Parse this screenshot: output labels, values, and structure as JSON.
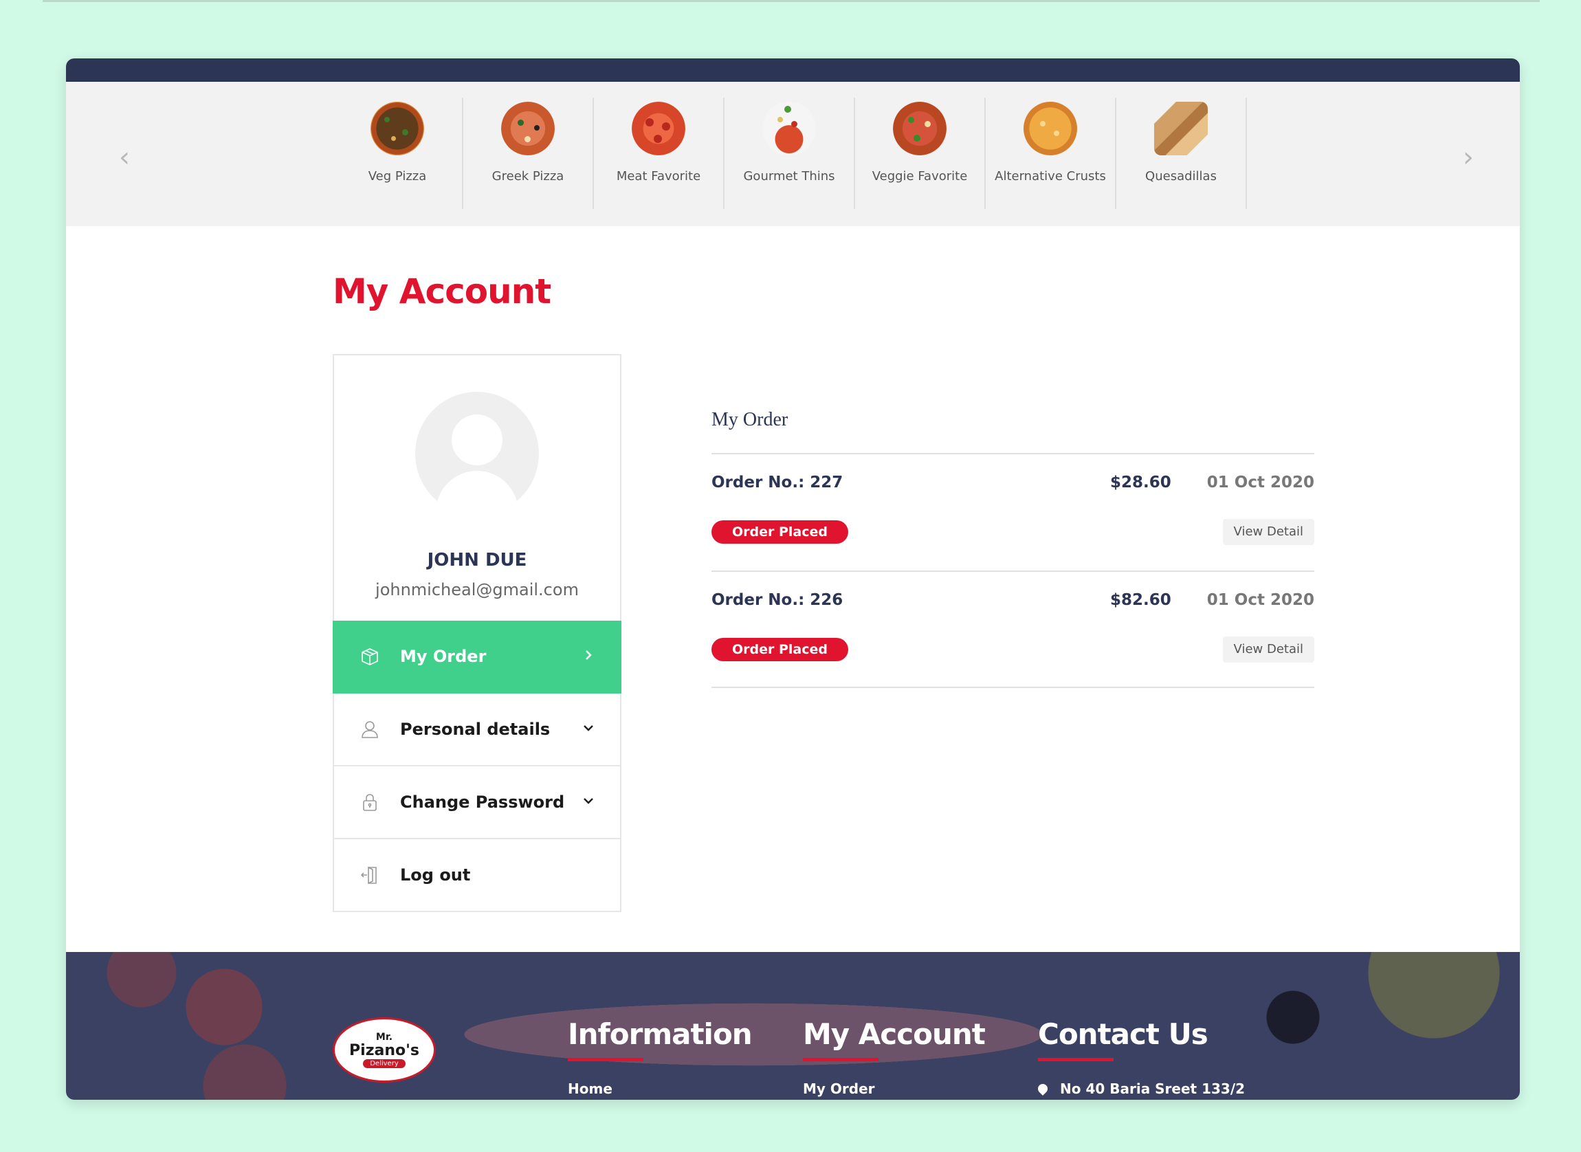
{
  "categories": [
    {
      "label": "Veg Pizza",
      "img": "veg-pizza-image"
    },
    {
      "label": "Greek Pizza",
      "img": "greek-pizza-image"
    },
    {
      "label": "Meat Favorite",
      "img": "meat-favorite-image"
    },
    {
      "label": "Gourmet Thins",
      "img": "gourmet-thins-image"
    },
    {
      "label": "Veggie Favorite",
      "img": "veggie-favorite-image"
    },
    {
      "label": "Alternative Crusts",
      "img": "alternative-crusts-image"
    },
    {
      "label": "Quesadillas",
      "img": "quesadillas-image"
    }
  ],
  "page": {
    "title": "My Account"
  },
  "profile": {
    "name": "JOHN DUE",
    "email": "johnmicheal@gmail.com"
  },
  "menu": [
    {
      "label": "My Order",
      "icon": "box-icon",
      "chevron": "chevron-right-icon",
      "active": true
    },
    {
      "label": "Personal details",
      "icon": "user-icon",
      "chevron": "chevron-down-icon",
      "active": false
    },
    {
      "label": "Change Password",
      "icon": "lock-icon",
      "chevron": "chevron-down-icon",
      "active": false
    },
    {
      "label": "Log out",
      "icon": "logout-icon",
      "chevron": "",
      "active": false
    }
  ],
  "orders": {
    "title": "My Order",
    "items": [
      {
        "number": "Order No.: 227",
        "price": "$28.60",
        "date": "01 Oct 2020",
        "status": "Order Placed",
        "action": "View Detail"
      },
      {
        "number": "Order No.: 226",
        "price": "$82.60",
        "date": "01 Oct 2020",
        "status": "Order Placed",
        "action": "View Detail"
      }
    ]
  },
  "footer": {
    "logo": {
      "mr": "Mr.",
      "name": "Pizano's",
      "tag": "Delivery"
    },
    "columns": [
      {
        "title": "Information",
        "first_link": "Home"
      },
      {
        "title": "My Account",
        "first_link": "My Order"
      },
      {
        "title": "Contact Us",
        "first_link": "No 40 Baria Sreet 133/2"
      }
    ]
  },
  "colors": {
    "brand_red": "#e0142f",
    "active_green": "#40d08b",
    "navy": "#2d3555",
    "background": "#d0f9e6"
  }
}
